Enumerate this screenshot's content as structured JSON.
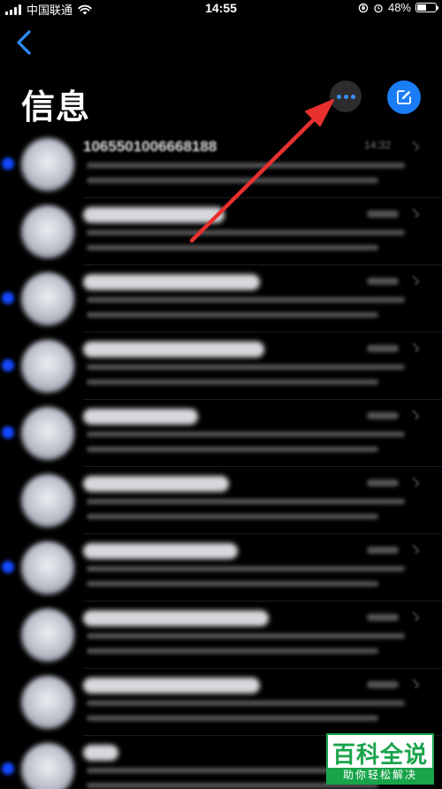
{
  "status_bar": {
    "carrier": "中国联通",
    "time": "14:55",
    "battery_text": "48%",
    "battery_level": 0.48
  },
  "nav": {
    "title": "信息",
    "back_icon": "chevron-left-icon",
    "more_icon": "ellipsis-icon",
    "compose_icon": "compose-icon"
  },
  "messages": [
    {
      "sender": "1065501006668188",
      "time": "14:32",
      "unread": true
    },
    {
      "sender": "",
      "time": "",
      "unread": false
    },
    {
      "sender": "",
      "time": "",
      "unread": true
    },
    {
      "sender": "",
      "time": "",
      "unread": true
    },
    {
      "sender": "",
      "time": "",
      "unread": true
    },
    {
      "sender": "",
      "time": "",
      "unread": false
    },
    {
      "sender": "",
      "time": "",
      "unread": true
    },
    {
      "sender": "",
      "time": "",
      "unread": false
    },
    {
      "sender": "",
      "time": "",
      "unread": false
    },
    {
      "sender": "",
      "time": "",
      "unread": true
    }
  ],
  "watermark": {
    "title": "百科全说",
    "subtitle": "助你轻松解决"
  },
  "colors": {
    "accent": "#1a7df5",
    "annotation": "#e8312f",
    "unread_dot": "#1348ff",
    "watermark": "#19a44a"
  }
}
